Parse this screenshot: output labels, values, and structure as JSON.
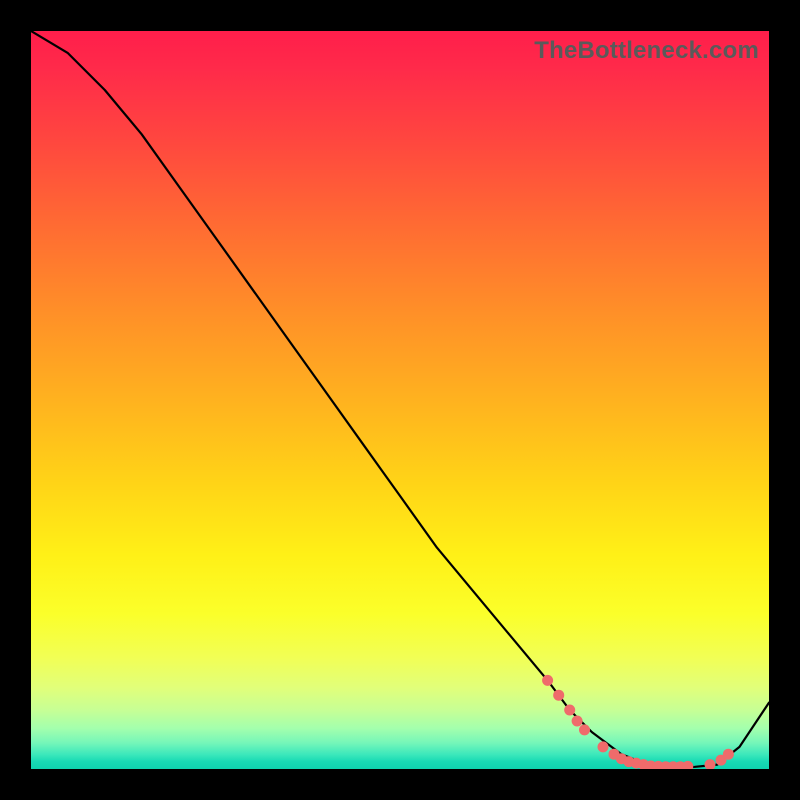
{
  "watermark": "TheBottleneck.com",
  "colors": {
    "dot": "#ef6b6b",
    "curve": "#000000",
    "frame": "#000000"
  },
  "chart_data": {
    "type": "line",
    "title": "",
    "xlabel": "",
    "ylabel": "",
    "xlim": [
      0,
      100
    ],
    "ylim": [
      0,
      100
    ],
    "grid": false,
    "legend": false,
    "series": [
      {
        "name": "curve",
        "x": [
          0,
          5,
          10,
          15,
          20,
          25,
          30,
          35,
          40,
          45,
          50,
          55,
          60,
          65,
          70,
          73,
          76,
          80,
          83,
          86,
          88,
          90,
          93,
          96,
          100
        ],
        "y": [
          100,
          97,
          92,
          86,
          79,
          72,
          65,
          58,
          51,
          44,
          37,
          30,
          24,
          18,
          12,
          8,
          5,
          2,
          0.8,
          0.3,
          0.2,
          0.3,
          0.6,
          3,
          9
        ]
      }
    ],
    "points": [
      {
        "name": "p1",
        "x": 70.0,
        "y": 12.0
      },
      {
        "name": "p2",
        "x": 71.5,
        "y": 10.0
      },
      {
        "name": "p3",
        "x": 73.0,
        "y": 8.0
      },
      {
        "name": "p4",
        "x": 74.0,
        "y": 6.5
      },
      {
        "name": "p5",
        "x": 75.0,
        "y": 5.3
      },
      {
        "name": "p6",
        "x": 77.5,
        "y": 3.0
      },
      {
        "name": "p7",
        "x": 79.0,
        "y": 2.0
      },
      {
        "name": "p8",
        "x": 80.0,
        "y": 1.4
      },
      {
        "name": "p9",
        "x": 81.0,
        "y": 1.0
      },
      {
        "name": "p10",
        "x": 82.0,
        "y": 0.8
      },
      {
        "name": "p11",
        "x": 83.0,
        "y": 0.6
      },
      {
        "name": "p12",
        "x": 84.0,
        "y": 0.4
      },
      {
        "name": "p13",
        "x": 85.0,
        "y": 0.35
      },
      {
        "name": "p14",
        "x": 86.0,
        "y": 0.3
      },
      {
        "name": "p15",
        "x": 87.0,
        "y": 0.3
      },
      {
        "name": "p16",
        "x": 88.0,
        "y": 0.3
      },
      {
        "name": "p17",
        "x": 89.0,
        "y": 0.35
      },
      {
        "name": "p18",
        "x": 92.0,
        "y": 0.6
      },
      {
        "name": "p19",
        "x": 93.5,
        "y": 1.2
      },
      {
        "name": "p20",
        "x": 94.5,
        "y": 2.0
      }
    ]
  }
}
